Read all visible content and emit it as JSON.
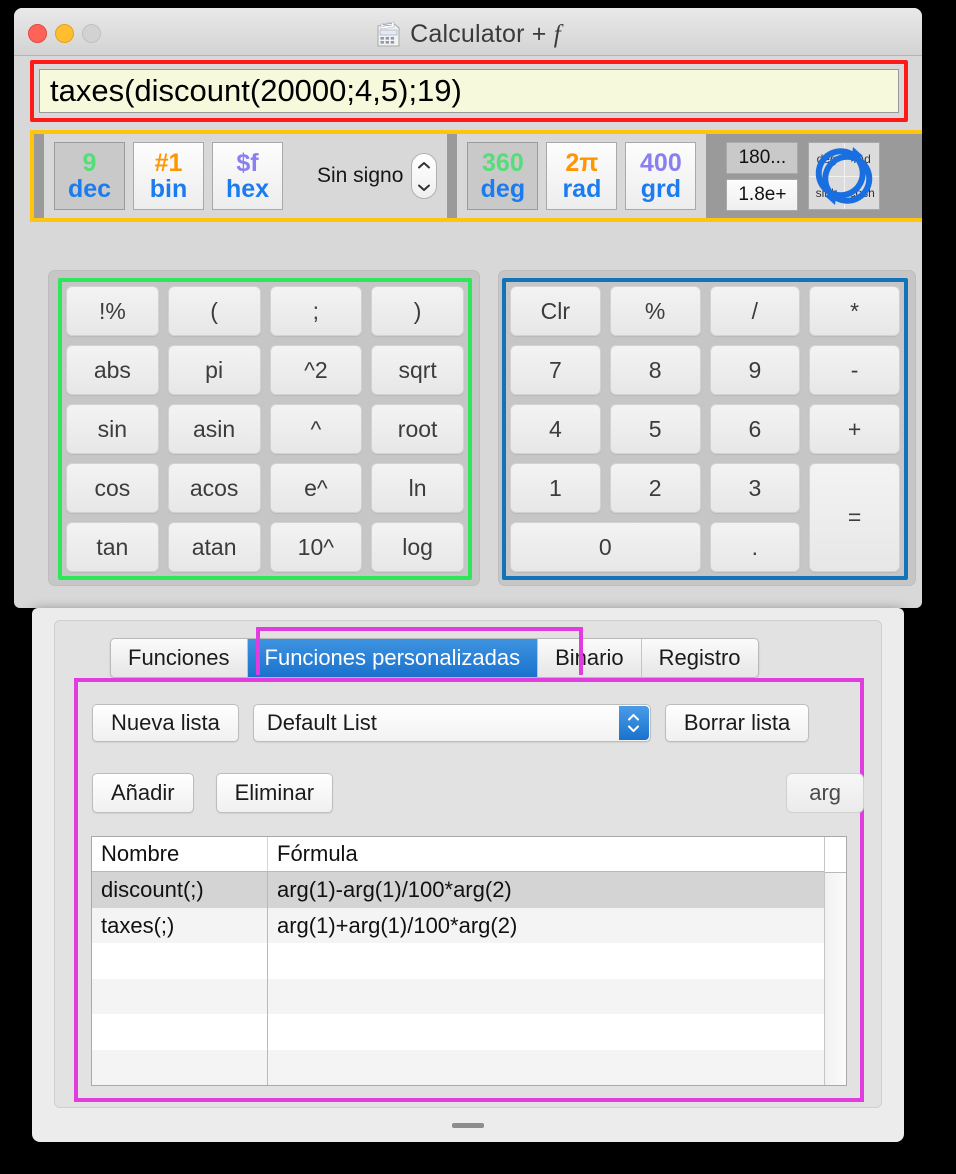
{
  "window": {
    "title": "Calculator + ",
    "title_italic": "f",
    "icon": "calculator-icon"
  },
  "expression": {
    "value": "taxes(discount(20000;4,5);19)"
  },
  "toolbar": {
    "base_modes": [
      {
        "top": "9",
        "bottom": "dec",
        "selected": true,
        "top_color": "#55dd77"
      },
      {
        "top": "#1",
        "bottom": "bin",
        "selected": false,
        "top_color": "#ff9500"
      },
      {
        "top": "$f",
        "bottom": "hex",
        "selected": false,
        "top_color": "#8a7ff0"
      }
    ],
    "sign_label": "Sin signo",
    "angle_modes": [
      {
        "top": "360",
        "bottom": "deg",
        "selected": true,
        "top_color": "#55dd77"
      },
      {
        "top": "2π",
        "bottom": "rad",
        "selected": false,
        "top_color": "#ff9500"
      },
      {
        "top": "400",
        "bottom": "grd",
        "selected": false,
        "top_color": "#8a7ff0"
      }
    ],
    "notation": [
      {
        "label": "180...",
        "selected": true
      },
      {
        "label": "1.8e+",
        "selected": false
      }
    ],
    "hyp_toggle": {
      "cells": [
        "deg",
        "rad",
        "sinh",
        "cosh"
      ],
      "icon": "refresh-circle-icon"
    }
  },
  "function_keys": [
    "!%",
    "(",
    ";",
    ")",
    "abs",
    "pi",
    "^2",
    "sqrt",
    "sin",
    "asin",
    "^",
    "root",
    "cos",
    "acos",
    "e^",
    "ln",
    "tan",
    "atan",
    "10^",
    "log"
  ],
  "numeric_keys": [
    {
      "label": "Clr",
      "span": ""
    },
    {
      "label": "%",
      "span": ""
    },
    {
      "label": "/",
      "span": ""
    },
    {
      "label": "*",
      "span": ""
    },
    {
      "label": "7",
      "span": ""
    },
    {
      "label": "8",
      "span": ""
    },
    {
      "label": "9",
      "span": ""
    },
    {
      "label": "-",
      "span": ""
    },
    {
      "label": "4",
      "span": ""
    },
    {
      "label": "5",
      "span": ""
    },
    {
      "label": "6",
      "span": ""
    },
    {
      "label": "+",
      "span": ""
    },
    {
      "label": "1",
      "span": ""
    },
    {
      "label": "2",
      "span": ""
    },
    {
      "label": "3",
      "span": ""
    },
    {
      "label": "=",
      "span": "span2row"
    },
    {
      "label": "0",
      "span": "span2col"
    },
    {
      "label": ".",
      "span": ""
    }
  ],
  "tabs": [
    {
      "label": "Funciones",
      "active": false
    },
    {
      "label": "Funciones personalizadas",
      "active": true
    },
    {
      "label": "Binario",
      "active": false
    },
    {
      "label": "Registro",
      "active": false
    }
  ],
  "list_controls": {
    "new_list": "Nueva lista",
    "selected_list": "Default List",
    "delete_list": "Borrar lista"
  },
  "item_controls": {
    "add": "Añadir",
    "remove": "Eliminar",
    "arg": "arg"
  },
  "table": {
    "headers": [
      "Nombre",
      "Fórmula"
    ],
    "rows": [
      {
        "name": "discount(;)",
        "formula": "arg(1)-arg(1)/100*arg(2)",
        "selected": true
      },
      {
        "name": "taxes(;)",
        "formula": "arg(1)+arg(1)/100*arg(2)",
        "selected": false
      },
      {
        "name": "",
        "formula": "",
        "selected": false
      },
      {
        "name": "",
        "formula": "",
        "selected": false
      },
      {
        "name": "",
        "formula": "",
        "selected": false
      },
      {
        "name": "",
        "formula": "",
        "selected": false
      }
    ]
  },
  "annotation_colors": {
    "expression_box": "#ff1a1a",
    "toolbar_box": "#ffc40c",
    "function_pad_box": "#2ee65a",
    "numeric_pad_box": "#1273b8",
    "custom_tab_box": "#e03ce0"
  }
}
